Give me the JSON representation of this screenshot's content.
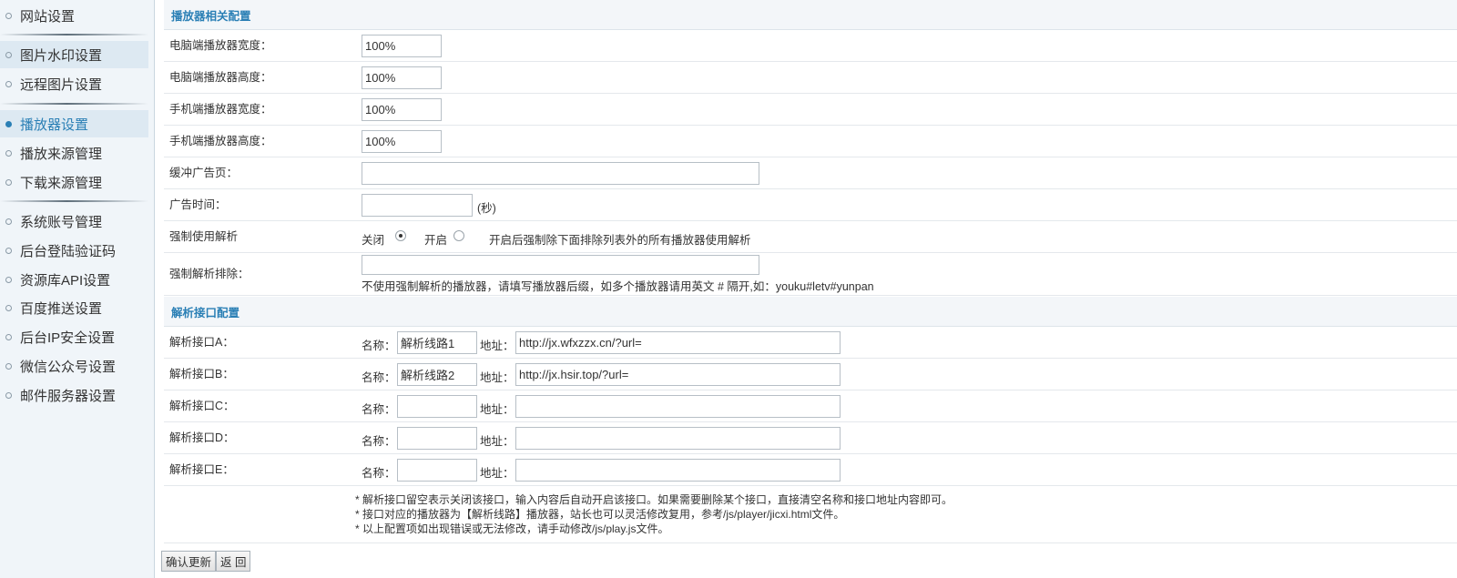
{
  "sidebar": {
    "items": [
      {
        "label": "网站设置"
      },
      {
        "label": "图片水印设置"
      },
      {
        "label": "远程图片设置"
      },
      {
        "label": "播放器设置"
      },
      {
        "label": "播放来源管理"
      },
      {
        "label": "下载来源管理"
      },
      {
        "label": "系统账号管理"
      },
      {
        "label": "后台登陆验证码"
      },
      {
        "label": "资源库API设置"
      },
      {
        "label": "百度推送设置"
      },
      {
        "label": "后台IP安全设置"
      },
      {
        "label": "微信公众号设置"
      },
      {
        "label": "邮件服务器设置"
      }
    ]
  },
  "player": {
    "title": "播放器相关配置",
    "pc_width_label": "电脑端播放器宽度：",
    "pc_width_value": "100%",
    "pc_height_label": "电脑端播放器高度：",
    "pc_height_value": "100%",
    "mobile_width_label": "手机端播放器宽度：",
    "mobile_width_value": "100%",
    "mobile_height_label": "手机端播放器高度：",
    "mobile_height_value": "100%",
    "buffer_ad_label": "缓冲广告页：",
    "buffer_ad_value": "",
    "ad_time_label": "广告时间：",
    "ad_time_value": "",
    "ad_time_unit": "(秒)",
    "force_parse_label": "强制使用解析",
    "force_off_label": "关闭",
    "force_on_label": "开启",
    "force_hint": "开启后强制除下面排除列表外的所有播放器使用解析",
    "force_exclude_label": "强制解析排除：",
    "force_exclude_value": "",
    "force_exclude_hint": "不使用强制解析的播放器，请填写播放器后缀，如多个播放器请用英文 # 隔开,如：youku#letv#yunpan"
  },
  "parse": {
    "title": "解析接口配置",
    "name_label": "名称：",
    "addr_label": "地址：",
    "interfaces": [
      {
        "label": "解析接口A：",
        "name": "解析线路1",
        "url": "http://jx.wfxzzx.cn/?url="
      },
      {
        "label": "解析接口B：",
        "name": "解析线路2",
        "url": "http://jx.hsir.top/?url="
      },
      {
        "label": "解析接口C：",
        "name": "",
        "url": ""
      },
      {
        "label": "解析接口D：",
        "name": "",
        "url": ""
      },
      {
        "label": "解析接口E：",
        "name": "",
        "url": ""
      }
    ],
    "notes": [
      "* 解析接口留空表示关闭该接口，输入内容后自动开启该接口。如果需要删除某个接口，直接清空名称和接口地址内容即可。",
      "* 接口对应的播放器为【解析线路】播放器，站长也可以灵活修改复用，参考/js/player/jicxi.html文件。",
      "* 以上配置项如出现错误或无法修改，请手动修改/js/play.js文件。"
    ]
  },
  "footer": {
    "confirm_label": "确认更新",
    "back_label": "返 回"
  }
}
